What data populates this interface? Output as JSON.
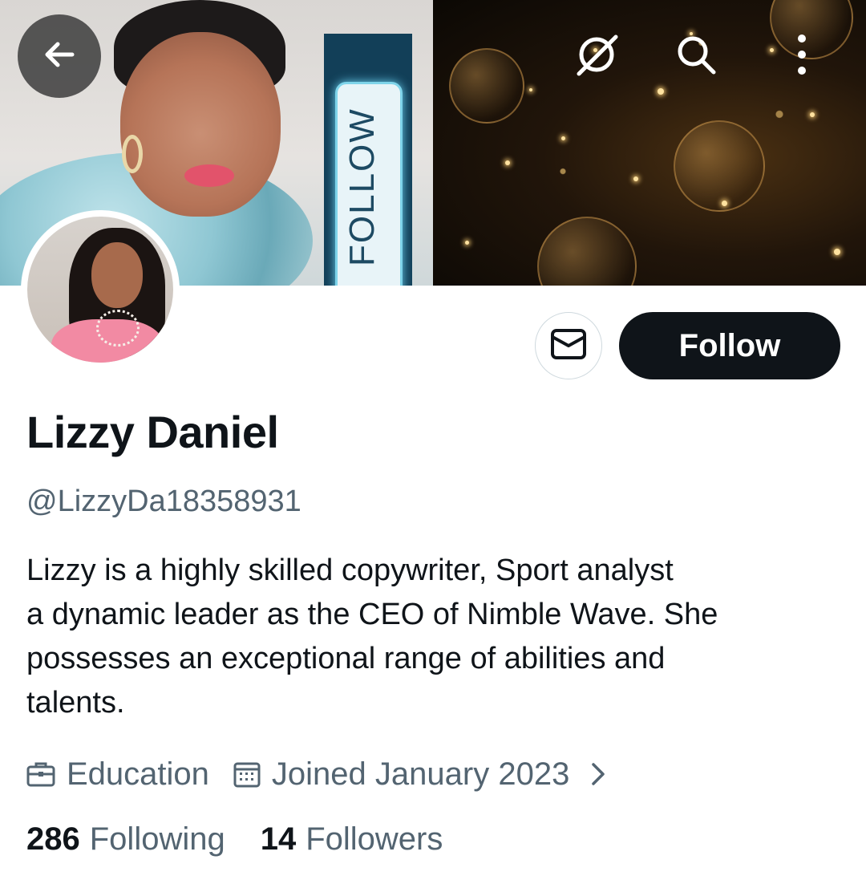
{
  "banner": {
    "follow_strip_text": "FOLLOW"
  },
  "header": {
    "icons": [
      "back-arrow-icon",
      "grok-icon",
      "search-icon",
      "more-vertical-icon"
    ]
  },
  "profile": {
    "name": "Lizzy Daniel",
    "handle": "@LizzyDa18358931",
    "bio_lines": [
      "Lizzy is a highly skilled copywriter,  Sport analyst",
      "a dynamic leader as the CEO of Nimble Wave. She",
      "possesses an exceptional range of abilities and",
      "talents."
    ],
    "category": "Education",
    "joined": "Joined January 2023",
    "following_count": "286",
    "following_label": "Following",
    "followers_count": "14",
    "followers_label": "Followers"
  },
  "actions": {
    "follow_label": "Follow",
    "message_icon": "envelope-icon"
  },
  "colors": {
    "primary_text": "#0f1419",
    "secondary_text": "#536471",
    "button_dark": "#0f1419",
    "border": "#cfd9de"
  }
}
